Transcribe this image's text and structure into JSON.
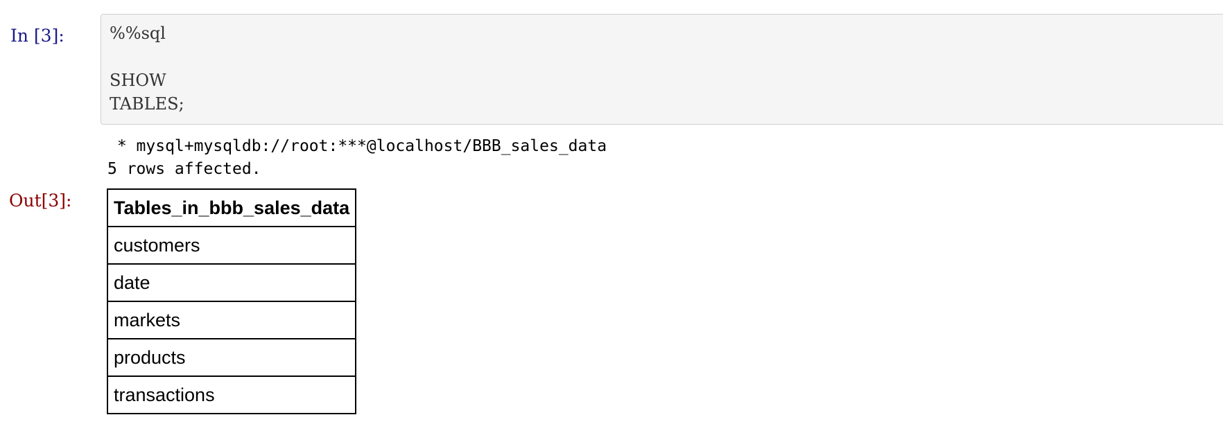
{
  "cell": {
    "in_prompt": "In [3]:",
    "out_prompt": "Out[3]:",
    "code_lines": [
      "%%sql",
      "",
      "SHOW",
      "TABLES;"
    ],
    "stream": {
      "connection": " * mysql+mysqldb://root:***@localhost/BBB_sales_data",
      "rows_affected": "5 rows affected."
    },
    "result_table": {
      "header": "Tables_in_bbb_sales_data",
      "rows": [
        "customers",
        "date",
        "markets",
        "products",
        "transactions"
      ]
    }
  }
}
